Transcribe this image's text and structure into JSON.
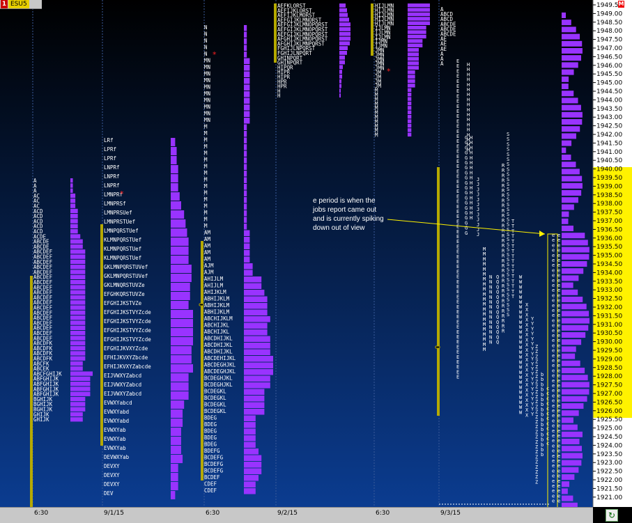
{
  "window": {
    "number": "1",
    "symbol": "ESU5",
    "m_label": "M"
  },
  "colors": {
    "bg_top": "#000000",
    "bg_bottom": "#0b3c90",
    "tpo_text": "#ffffff",
    "profile": "#9933ff",
    "value_area": "#b5a900",
    "highlight": "#fff200"
  },
  "price_axis": {
    "labels": [
      "1949.5",
      "1949.00",
      "1948.50",
      "1948.00",
      "1947.50",
      "1947.00",
      "1946.50",
      "1946.00",
      "1945.50",
      "1945.00",
      "1944.50",
      "1944.00",
      "1943.50",
      "1943.00",
      "1942.50",
      "1942.00",
      "1941.50",
      "1941.00",
      "1940.50",
      "1940.00",
      "1939.50",
      "1939.00",
      "1938.50",
      "1938.00",
      "1937.50",
      "1937.00",
      "1936.50",
      "1936.00",
      "1935.50",
      "1935.00",
      "1934.50",
      "1934.00",
      "1933.50",
      "1933.00",
      "1932.50",
      "1932.00",
      "1931.50",
      "1931.00",
      "1930.50",
      "1930.00",
      "1929.50",
      "1929.00",
      "1928.50",
      "1928.00",
      "1927.50",
      "1927.00",
      "1926.50",
      "1926.00",
      "1925.50",
      "1925.00",
      "1924.50",
      "1924.00",
      "1923.50",
      "1923.00",
      "1922.50",
      "1922.00",
      "1921.50",
      "1921.00"
    ],
    "value_area_high": "1940.00",
    "value_area_low": "1926.00",
    "current_price": "1931.50"
  },
  "time_axis": {
    "labels": [
      "6:30",
      "9/1/15",
      "6:30",
      "9/2/15",
      "6:30",
      "9/3/15"
    ]
  },
  "annotation": {
    "lines": [
      "e period is when the",
      "jobs report came out",
      "and is currently spiking",
      "down out of view"
    ]
  },
  "sessions": [
    {
      "rows": [
        "A",
        "A",
        "A",
        "AC",
        "AC",
        "AC",
        "ACD",
        "ACD",
        "ACD",
        "ACD",
        "ACD",
        "ACDE",
        "ABCDE",
        "ABCDE",
        "ABCDEF",
        "ABCDEF",
        "ABCDEF",
        "ABCDEF",
        "ABCDEF",
        "ABCDEF",
        "ABCDEF",
        "ABCDEF",
        "ABCDEF",
        "ABCDEF",
        "ABCDEF",
        "ABCDEF",
        "ABCDEF",
        "ABCDEF",
        "ABCDEF",
        "ABCDEF",
        "ABCDEF",
        "ABCDEF",
        "ABCDFK",
        "ABCDFK",
        "ABCDFK",
        "ABCDFK",
        "ABCFK",
        "ABCEK",
        "ABCFGHIJK",
        "ABFGHIJK",
        "ABFGHIJK",
        "ABFGHIJK",
        "ABFGHIJK",
        "BGHIJK",
        "BGHIJK",
        "BGHIJK",
        "GHIJK",
        "GHIJK"
      ]
    },
    {
      "rows": [
        "LRf",
        "LPRf",
        "LPRf",
        "LNPRf",
        "LNPRf",
        "LNPRf",
        "LMNPRf",
        "LMNPRSf",
        "LMNPRSUef",
        "LMNPRSTUef",
        "LMNPQRSTUef",
        "KLMNPQRSTUef",
        "KLMNPQRSTUef",
        "KLMNPQRSTUef",
        "GKLMNPQRSTUVef",
        "GKLMNPQRSTUVef",
        "GKLMNQRSTUVZe",
        "EFGHKQRSTUVZe",
        "EFGHIJKSTVZe",
        "EFGHIJKSTVYZcde",
        "EFGHIJKSTVYZcde",
        "EFGHIJKSTVYZcde",
        "EFGHIJKSTVYZcde",
        "EFGHIJKVXYZcde",
        "EFHIJKVXYZbcde",
        "EFHIJKVXYZabcde",
        "EIJVWXYZabcd",
        "EIJVWXYZabcd",
        "EIJVWXYZabcd",
        "EVWXYabcd",
        "EVWXYabd",
        "EVWXYabd",
        "EVWXYab",
        "EVWXYab",
        "EVWXYab",
        "DEVWXYab",
        "DEVXY",
        "DEVXY",
        "DEVXY",
        "DEV"
      ]
    },
    {
      "rows": [
        "N",
        "N",
        "N",
        "N",
        "N",
        "MN",
        "MN",
        "MN",
        "MN",
        "MN",
        "MN",
        "MN",
        "MN",
        "MN",
        "MN",
        "M",
        "M",
        "M",
        "M",
        "M",
        "M",
        "M",
        "M",
        "M",
        "M",
        "M",
        "M",
        "M",
        "M",
        "M",
        "M",
        "AM",
        "AM",
        "AM",
        "AM",
        "AM",
        "AJM",
        "AJM",
        "AHIJLM",
        "AHIJLM",
        "AHIJKLM",
        "ABHIJKLM",
        "ABHIJKLM",
        "ABHIJKLM",
        "ABCHIJKLM",
        "ABCHIJKL",
        "ABCHIJKL",
        "ABCDHIJKL",
        "ABCDHIJKL",
        "ABCDHIJKL",
        "ABCDEHIJKL",
        "ABCDEGHJKL",
        "ABCDEGHJKL",
        "BCDEGHJKL",
        "BCDEGHJKL",
        "BCDEGKL",
        "BCDEGKL",
        "BCDEGKL",
        "BCDEGKL",
        "BDEG",
        "BDEG",
        "BDEG",
        "BDEG",
        "BDEG",
        "BDEFG",
        "BCDEFG",
        "BCDEFG",
        "BCDEFG",
        "BCDEF",
        "CDEF",
        "CDEF"
      ]
    },
    {
      "rows": [
        "AEFKLORST",
        "AEFIJKLORST",
        "AEFIJKLMORST",
        "AEFGIJKLMNORST",
        "AEFGIJKLMNOPQRST",
        "AEFGIJKLMNOPQRST",
        "AEFGIJKLMNOPQRST",
        "AFGHIJKLMNOPQRST",
        "AFGHIJKLMNPQRST",
        "FGHIJLNPQRST",
        "FGHIJLNPQRT",
        "GHINPQRT",
        "GHINPQRT",
        "HIPQR",
        "HIPR",
        "HIPR",
        "HPR",
        "HPR",
        "H",
        "H"
      ]
    },
    {
      "rows": [
        "HIJLMN",
        "HIJLMN",
        "HIJLMN",
        "HIJLMN",
        "HIJLMN",
        "IJLMN",
        "IJLMN",
        "IJLMN",
        "IJMN",
        "IJMN",
        "JMN",
        "JMN",
        "JMN",
        "JMN",
        "JMN",
        "JM",
        "JM",
        "JM",
        "JM",
        "M",
        "M",
        "M",
        "M",
        "M",
        "M",
        "M",
        "M",
        "M",
        "M",
        "M"
      ]
    },
    {
      "rows": [
        "A",
        "ABCD",
        "ABCD",
        "ABCDE",
        "ABCDE",
        "ABCDE",
        "AE",
        "AE",
        "AE",
        "A",
        "A",
        "A"
      ]
    }
  ]
}
